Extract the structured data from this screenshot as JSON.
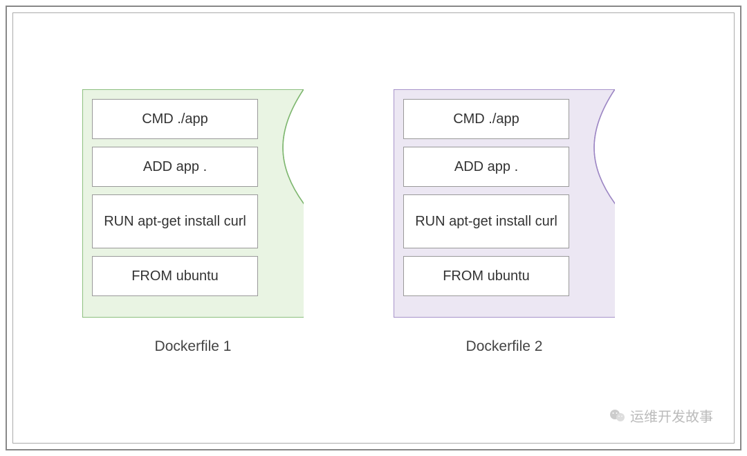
{
  "diagram": {
    "shapes": [
      {
        "id": "dockerfile-1",
        "fill": "#e9f4e3",
        "stroke": "#7fb770",
        "caption": "Dockerfile 1",
        "layers": [
          {
            "text": "CMD ./app",
            "tall": false
          },
          {
            "text": "ADD app .",
            "tall": false
          },
          {
            "text": "RUN apt-get install curl",
            "tall": true
          },
          {
            "text": "FROM ubuntu",
            "tall": false
          }
        ]
      },
      {
        "id": "dockerfile-2",
        "fill": "#ece7f3",
        "stroke": "#9d87c4",
        "caption": "Dockerfile 2",
        "layers": [
          {
            "text": "CMD ./app",
            "tall": false
          },
          {
            "text": "ADD app .",
            "tall": false
          },
          {
            "text": "RUN apt-get install curl",
            "tall": true
          },
          {
            "text": "FROM ubuntu",
            "tall": false
          }
        ]
      }
    ]
  },
  "watermark": {
    "text": "运维开发故事"
  }
}
